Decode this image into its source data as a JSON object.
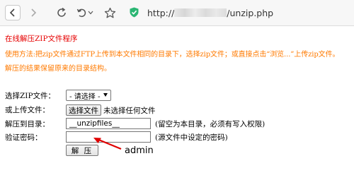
{
  "browser": {
    "url_prefix": "http://",
    "url_suffix": "/unzip.php",
    "icons": [
      "back-icon",
      "forward-icon",
      "reload-icon",
      "undo-icon",
      "dropdown-icon",
      "star-icon",
      "shield-check-icon"
    ],
    "accent_color": "#2bb673"
  },
  "page": {
    "title": "在线解压ZIP文件程序",
    "usage": "使用方法:把zip文件通过FTP上传到本文件相同的目录下，选择zip文件；或直接点击“浏览...”上传zip文件。",
    "note": "解压的结果保留原来的目录结构。",
    "title_color": "#e60000",
    "info_color": "#ff7a00"
  },
  "form": {
    "select_label": "选择ZIP文件：",
    "select_value": "- 请选择 -",
    "upload_label": "或上传文件：",
    "file_button": "选择文件",
    "file_status": "未选择任何文件",
    "dir_label": "解压到目录：",
    "dir_value": "__unzipfiles__",
    "dir_hint": "(留空为本目录，必须有写入权限)",
    "pwd_label": "验证密码：",
    "pwd_value": "",
    "pwd_hint": "(源文件中设定的密码)",
    "submit": "解 压"
  },
  "annotation": {
    "text": "admin",
    "arrow_color": "#e00000"
  }
}
